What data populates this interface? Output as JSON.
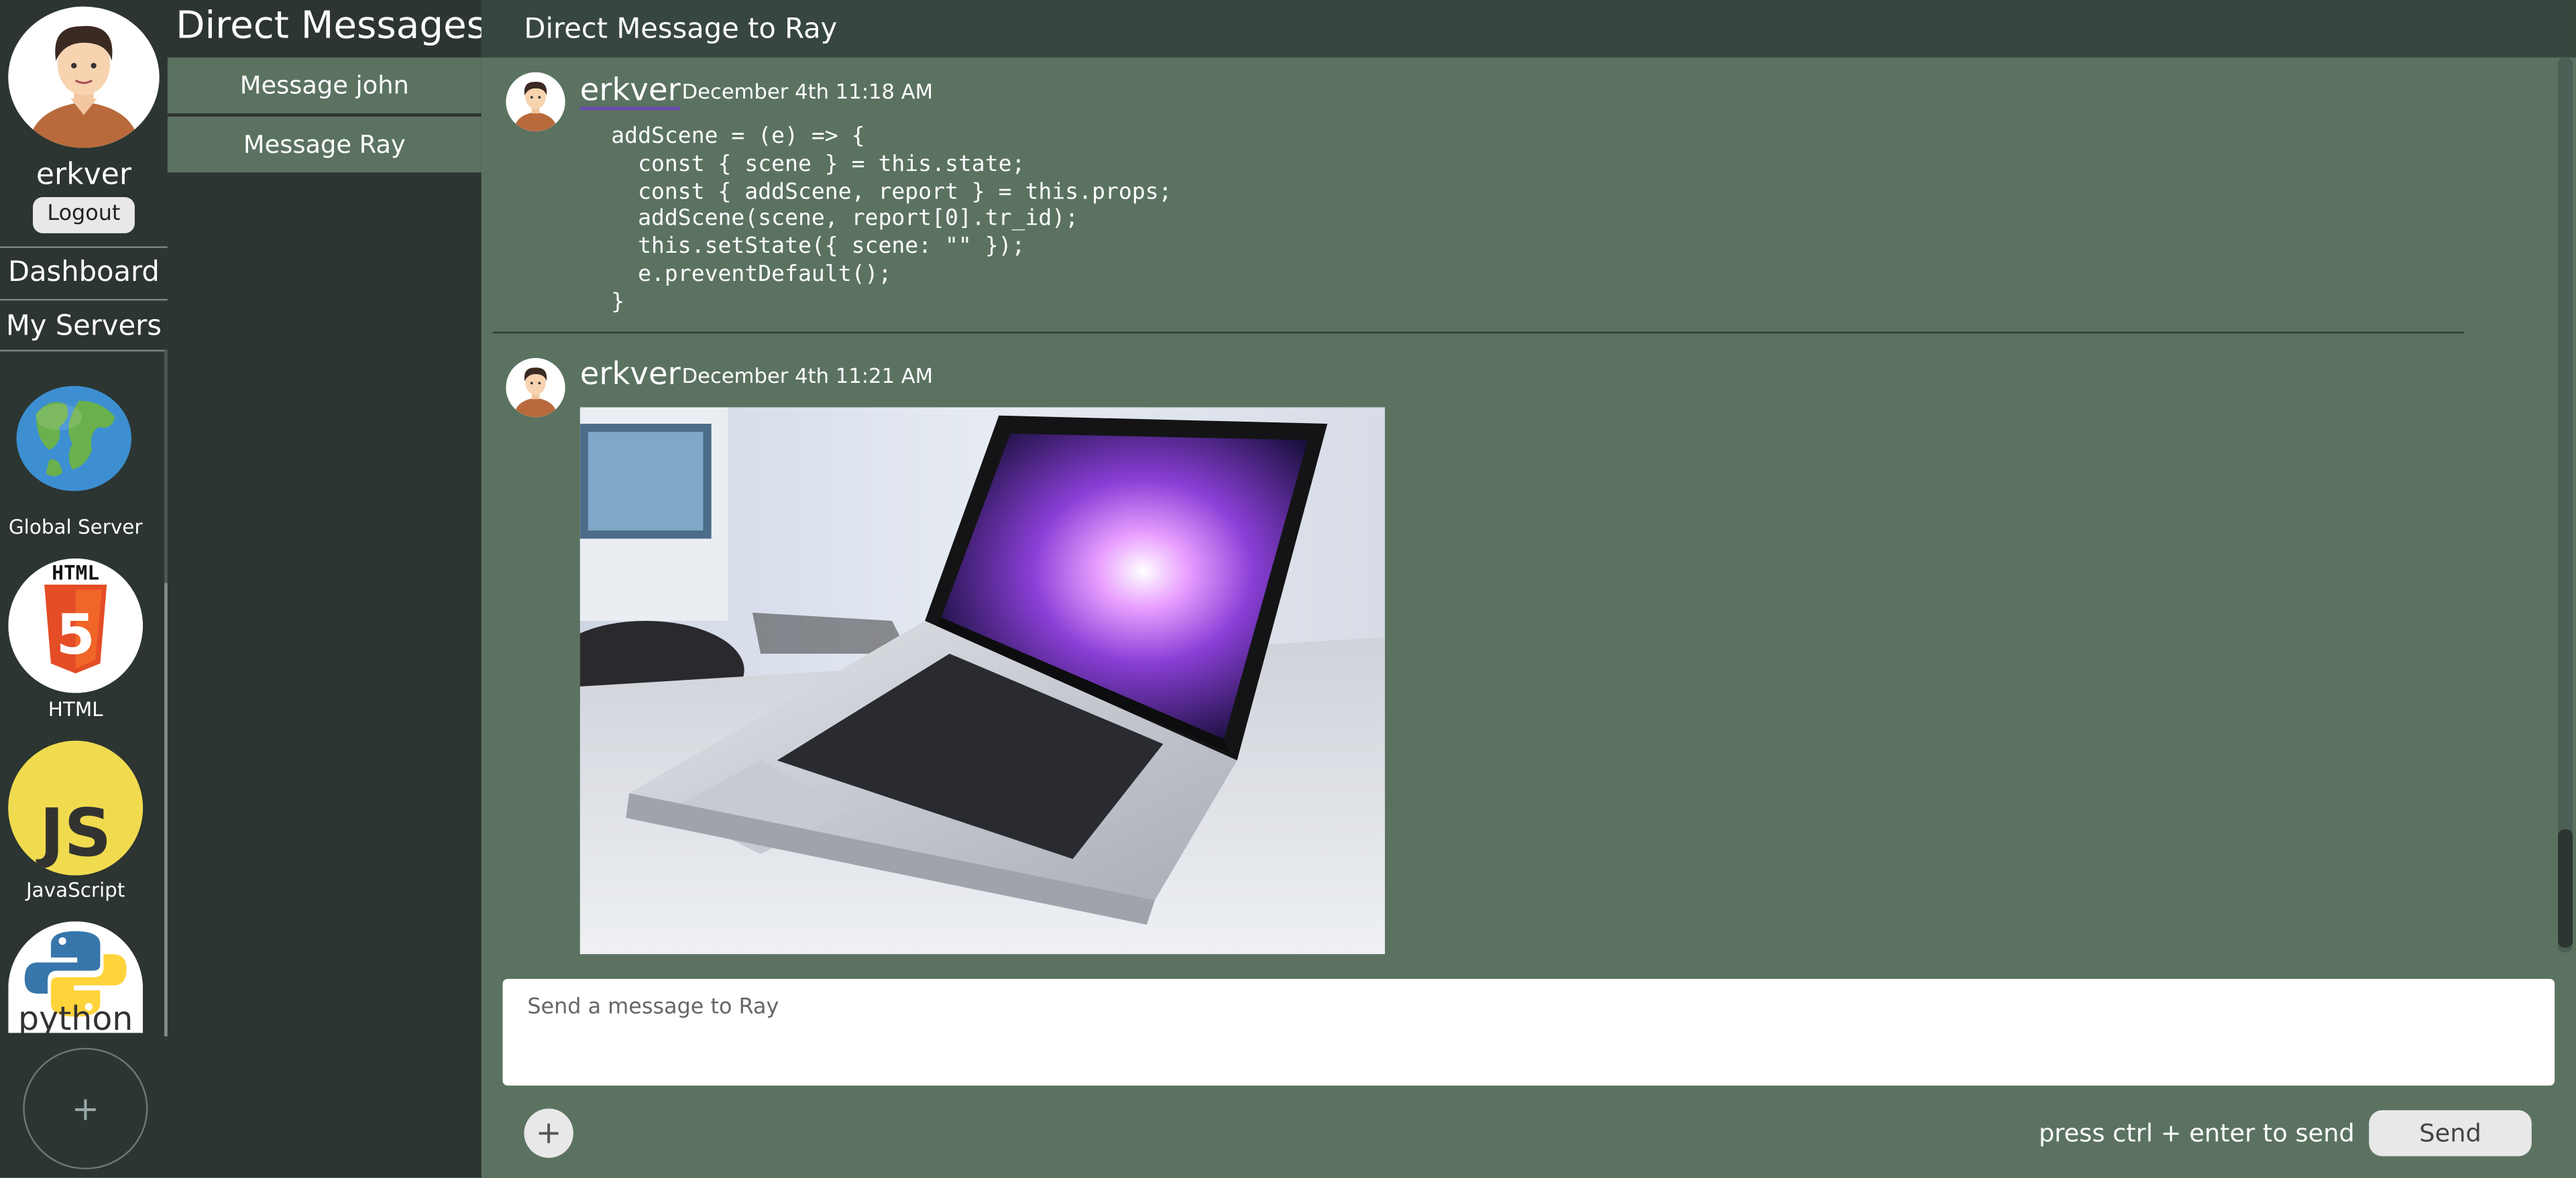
{
  "user": {
    "name": "erkver",
    "logout_label": "Logout"
  },
  "nav": {
    "dashboard": "Dashboard",
    "my_servers": "My Servers"
  },
  "servers": [
    {
      "name": "Global Server",
      "icon": "globe-icon"
    },
    {
      "name": "HTML",
      "icon": "html5-icon",
      "badge_text": "HTML",
      "glyph": "5"
    },
    {
      "name": "JavaScript",
      "icon": "javascript-icon",
      "glyph": "JS"
    },
    {
      "name": "python",
      "icon": "python-icon",
      "wordmark": "python"
    }
  ],
  "add_server_label": "+",
  "direct_messages": {
    "title": "Direct Messages",
    "items": [
      {
        "label": "Message john"
      },
      {
        "label": "Message Ray",
        "active": true
      }
    ]
  },
  "conversation": {
    "title": "Direct Message to Ray",
    "messages": [
      {
        "author": "erkver",
        "time": "December 4th 11:18 AM",
        "code": "addScene = (e) => {\n  const { scene } = this.state;\n  const { addScene, report } = this.props;\n  addScene(scene, report[0].tr_id);\n  this.setState({ scene: \"\" });\n  e.preventDefault();\n}"
      },
      {
        "author": "erkver",
        "time": "December 4th 11:21 AM",
        "image": "laptop-photo"
      }
    ]
  },
  "composer": {
    "placeholder": "Send a message to Ray",
    "attach_label": "+",
    "hint": "press ctrl + enter to send",
    "send_label": "Send"
  },
  "colors": {
    "panel_dark": "#2c3531",
    "panel_main": "#5b7261",
    "header": "#37463e",
    "username_underline": "#6a4bb0"
  }
}
